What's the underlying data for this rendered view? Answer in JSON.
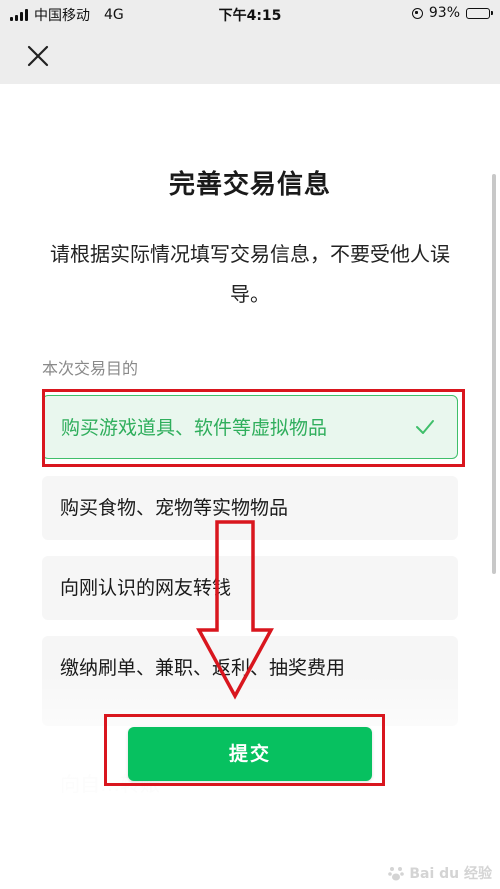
{
  "status_bar": {
    "carrier": "中国移动",
    "network": "4G",
    "time": "下午4:15",
    "battery": "93%",
    "battery_level": 0.93
  },
  "page": {
    "title": "完善交易信息",
    "description": "请根据实际情况填写交易信息，不要受他人误导。",
    "section_label": "本次交易目的"
  },
  "options": [
    {
      "label": "购买游戏道具、软件等虚拟物品",
      "selected": true
    },
    {
      "label": "购买食物、宠物等实物物品",
      "selected": false
    },
    {
      "label": "向刚认识的网友转钱",
      "selected": false
    },
    {
      "label": "缴纳刷单、兼职、返利、抽奖费用",
      "selected": false
    }
  ],
  "faded_options": [
    {
      "label": "向自…转账"
    }
  ],
  "submit_label": "提交",
  "watermark": "Bai du 经验",
  "colors": {
    "accent_green": "#07c160",
    "selected_text": "#2fae5c",
    "annotation_red": "#d9161e"
  }
}
